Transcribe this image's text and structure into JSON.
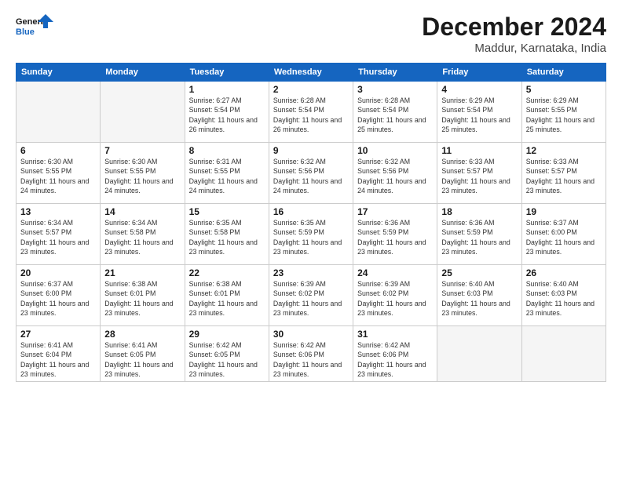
{
  "logo": {
    "line1": "General",
    "line2": "Blue"
  },
  "title": "December 2024",
  "location": "Maddur, Karnataka, India",
  "weekdays": [
    "Sunday",
    "Monday",
    "Tuesday",
    "Wednesday",
    "Thursday",
    "Friday",
    "Saturday"
  ],
  "days": [
    null,
    null,
    {
      "num": "1",
      "rise": "6:27 AM",
      "set": "5:54 PM",
      "daylight": "11 hours and 26 minutes."
    },
    {
      "num": "2",
      "rise": "6:28 AM",
      "set": "5:54 PM",
      "daylight": "11 hours and 26 minutes."
    },
    {
      "num": "3",
      "rise": "6:28 AM",
      "set": "5:54 PM",
      "daylight": "11 hours and 25 minutes."
    },
    {
      "num": "4",
      "rise": "6:29 AM",
      "set": "5:54 PM",
      "daylight": "11 hours and 25 minutes."
    },
    {
      "num": "5",
      "rise": "6:29 AM",
      "set": "5:55 PM",
      "daylight": "11 hours and 25 minutes."
    },
    {
      "num": "6",
      "rise": "6:30 AM",
      "set": "5:55 PM",
      "daylight": "11 hours and 24 minutes."
    },
    {
      "num": "7",
      "rise": "6:30 AM",
      "set": "5:55 PM",
      "daylight": "11 hours and 24 minutes."
    },
    {
      "num": "8",
      "rise": "6:31 AM",
      "set": "5:55 PM",
      "daylight": "11 hours and 24 minutes."
    },
    {
      "num": "9",
      "rise": "6:32 AM",
      "set": "5:56 PM",
      "daylight": "11 hours and 24 minutes."
    },
    {
      "num": "10",
      "rise": "6:32 AM",
      "set": "5:56 PM",
      "daylight": "11 hours and 24 minutes."
    },
    {
      "num": "11",
      "rise": "6:33 AM",
      "set": "5:57 PM",
      "daylight": "11 hours and 23 minutes."
    },
    {
      "num": "12",
      "rise": "6:33 AM",
      "set": "5:57 PM",
      "daylight": "11 hours and 23 minutes."
    },
    {
      "num": "13",
      "rise": "6:34 AM",
      "set": "5:57 PM",
      "daylight": "11 hours and 23 minutes."
    },
    {
      "num": "14",
      "rise": "6:34 AM",
      "set": "5:58 PM",
      "daylight": "11 hours and 23 minutes."
    },
    {
      "num": "15",
      "rise": "6:35 AM",
      "set": "5:58 PM",
      "daylight": "11 hours and 23 minutes."
    },
    {
      "num": "16",
      "rise": "6:35 AM",
      "set": "5:59 PM",
      "daylight": "11 hours and 23 minutes."
    },
    {
      "num": "17",
      "rise": "6:36 AM",
      "set": "5:59 PM",
      "daylight": "11 hours and 23 minutes."
    },
    {
      "num": "18",
      "rise": "6:36 AM",
      "set": "5:59 PM",
      "daylight": "11 hours and 23 minutes."
    },
    {
      "num": "19",
      "rise": "6:37 AM",
      "set": "6:00 PM",
      "daylight": "11 hours and 23 minutes."
    },
    {
      "num": "20",
      "rise": "6:37 AM",
      "set": "6:00 PM",
      "daylight": "11 hours and 23 minutes."
    },
    {
      "num": "21",
      "rise": "6:38 AM",
      "set": "6:01 PM",
      "daylight": "11 hours and 23 minutes."
    },
    {
      "num": "22",
      "rise": "6:38 AM",
      "set": "6:01 PM",
      "daylight": "11 hours and 23 minutes."
    },
    {
      "num": "23",
      "rise": "6:39 AM",
      "set": "6:02 PM",
      "daylight": "11 hours and 23 minutes."
    },
    {
      "num": "24",
      "rise": "6:39 AM",
      "set": "6:02 PM",
      "daylight": "11 hours and 23 minutes."
    },
    {
      "num": "25",
      "rise": "6:40 AM",
      "set": "6:03 PM",
      "daylight": "11 hours and 23 minutes."
    },
    {
      "num": "26",
      "rise": "6:40 AM",
      "set": "6:03 PM",
      "daylight": "11 hours and 23 minutes."
    },
    {
      "num": "27",
      "rise": "6:41 AM",
      "set": "6:04 PM",
      "daylight": "11 hours and 23 minutes."
    },
    {
      "num": "28",
      "rise": "6:41 AM",
      "set": "6:05 PM",
      "daylight": "11 hours and 23 minutes."
    },
    {
      "num": "29",
      "rise": "6:42 AM",
      "set": "6:05 PM",
      "daylight": "11 hours and 23 minutes."
    },
    {
      "num": "30",
      "rise": "6:42 AM",
      "set": "6:06 PM",
      "daylight": "11 hours and 23 minutes."
    },
    {
      "num": "31",
      "rise": "6:42 AM",
      "set": "6:06 PM",
      "daylight": "11 hours and 23 minutes."
    }
  ]
}
